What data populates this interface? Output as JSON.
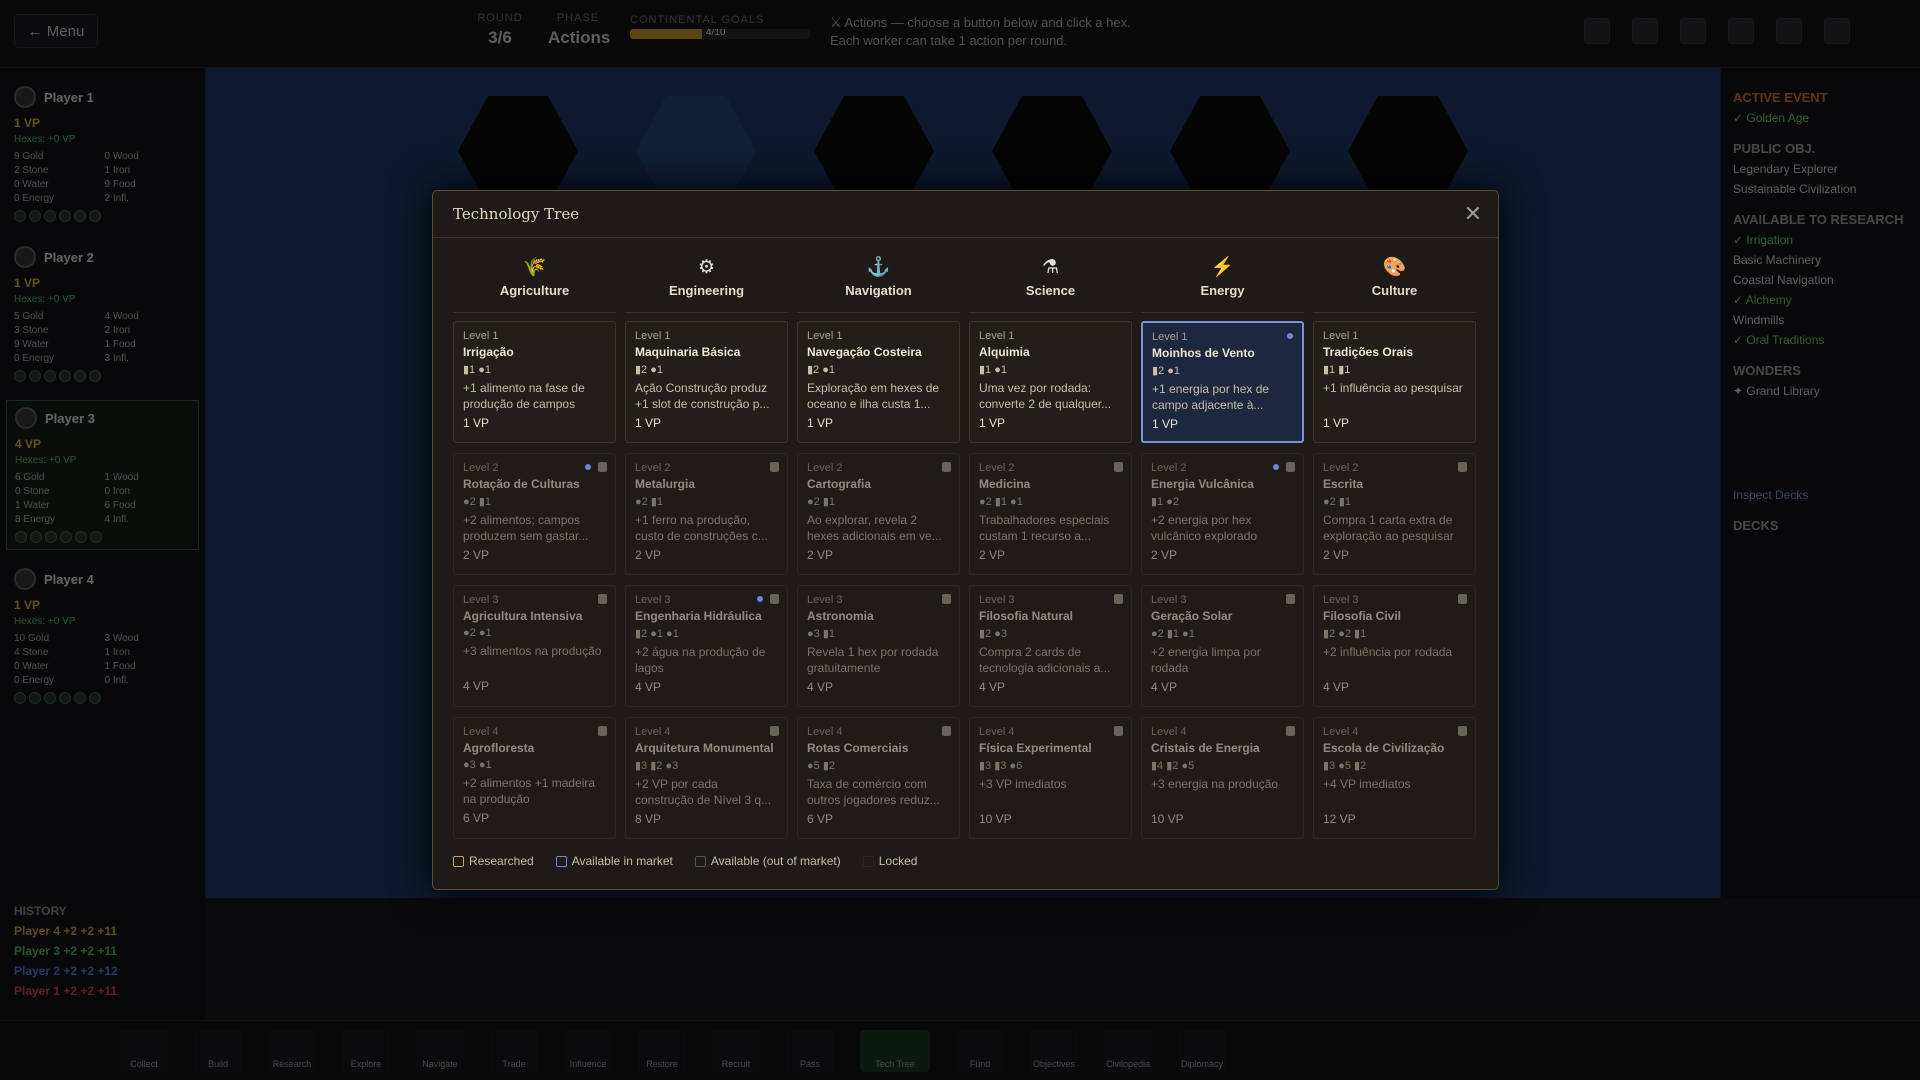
{
  "topbar": {
    "menu_label": "← Menu",
    "round_label": "ROUND",
    "round_value": "3/6",
    "phase_label": "PHASE",
    "phase_value": "Actions",
    "progress_label": "CONTINENTAL GOALS",
    "progress_text": "4/10",
    "progress_fraction": 0.4,
    "hint": "⚔ Actions — choose a button below and click a hex. Each worker can take 1 action per round."
  },
  "players": [
    {
      "name": "Player 1",
      "vp": "1 VP",
      "hexes": "Hexes: +0 VP",
      "res": [
        "9 Gold",
        "0 Wood",
        "2 Stone",
        "1 Iron",
        "0 Water",
        "9 Food",
        "0 Energy",
        "2 Infl."
      ]
    },
    {
      "name": "Player 2",
      "vp": "1 VP",
      "hexes": "Hexes: +0 VP",
      "res": [
        "5 Gold",
        "4 Wood",
        "3 Stone",
        "2 Iron",
        "9 Water",
        "1 Food",
        "0 Energy",
        "3 Infl."
      ]
    },
    {
      "name": "Player 3",
      "vp": "4 VP",
      "hexes": "Hexes: +0 VP",
      "res": [
        "6 Gold",
        "1 Wood",
        "0 Stone",
        "0 Iron",
        "1 Water",
        "6 Food",
        "8 Energy",
        "4 Infl."
      ]
    },
    {
      "name": "Player 4",
      "vp": "1 VP",
      "hexes": "Hexes: +0 VP",
      "res": [
        "10 Gold",
        "3 Wood",
        "4 Stone",
        "1 Iron",
        "0 Water",
        "1 Food",
        "0 Energy",
        "0 Infl."
      ]
    }
  ],
  "history": {
    "title": "HISTORY",
    "rows": [
      "Player 4 +2 +2 +11",
      "Player 3 +2 +2 +11",
      "Player 2 +2 +2 +12",
      "Player 1 +2 +2 +11"
    ]
  },
  "right": {
    "event_title": "ACTIVE EVENT",
    "event_name": "✓ Golden Age",
    "public_title": "PUBLIC OBJ.",
    "public_items": [
      "Legendary Explorer",
      "Sustainable Civilization"
    ],
    "avail_title": "AVAILABLE TO RESEARCH",
    "avail_items": [
      "✓ Irrigation",
      "Basic Machinery",
      "Coastal Navigation",
      "✓ Alchemy",
      "Windmills",
      "✓ Oral Traditions"
    ],
    "wonders_title": "WONDERS",
    "wonders_item": "✦ Grand Library",
    "inspect": "Inspect Decks",
    "decks_title": "DECKS"
  },
  "bottom": [
    "Collect",
    "Build",
    "Research",
    "Explore",
    "Navigate",
    "Trade",
    "Influence",
    "Restore",
    "Recruit",
    "Pass",
    "Tech Tree",
    "Fund",
    "Objectives",
    "Civilopedia",
    "Diplomacy"
  ],
  "modal": {
    "title": "Technology Tree",
    "columns": [
      {
        "name": "Agriculture",
        "icon": "🌾",
        "color": "#6fbf4a",
        "techs": [
          {
            "level": "Level 1",
            "name": "Irrigação",
            "cost": "▮1 ●1",
            "desc": "+1 alimento na fase de produção de campos",
            "vp": "1 VP",
            "state": "researched"
          },
          {
            "level": "Level 2",
            "name": "Rotação de Culturas",
            "cost": "●2 ▮1",
            "desc": "+2 alimentos; campos produzem sem gastar...",
            "vp": "2 VP",
            "state": "locked",
            "market": true
          },
          {
            "level": "Level 3",
            "name": "Agricultura Intensiva",
            "cost": "●2 ●1",
            "desc": "+3 alimentos na produção",
            "vp": "4 VP",
            "state": "locked"
          },
          {
            "level": "Level 4",
            "name": "Agrofloresta",
            "cost": "●3 ●1",
            "desc": "+2 alimentos +1 madeira na produção",
            "vp": "6 VP",
            "state": "locked"
          }
        ]
      },
      {
        "name": "Engineering",
        "icon": "⚙",
        "color": "#e0e0e0",
        "techs": [
          {
            "level": "Level 1",
            "name": "Maquinaria Básica",
            "cost": "▮2 ●1",
            "desc": "Ação Construção produz +1 slot de construção p...",
            "vp": "1 VP",
            "state": "researched"
          },
          {
            "level": "Level 2",
            "name": "Metalurgia",
            "cost": "●2 ▮1",
            "desc": "+1 ferro na produção, custo de construções c...",
            "vp": "2 VP",
            "state": "locked"
          },
          {
            "level": "Level 3",
            "name": "Engenharia Hidráulica",
            "cost": "▮2 ●1 ●1",
            "desc": "+2 água na produção de lagos",
            "vp": "4 VP",
            "state": "locked",
            "market": true
          },
          {
            "level": "Level 4",
            "name": "Arquitetura Monumental",
            "cost": "▮3 ▮2 ●3",
            "desc": "+2 VP por cada construção de Nível 3 q...",
            "vp": "8 VP",
            "state": "locked"
          }
        ]
      },
      {
        "name": "Navigation",
        "icon": "⚓",
        "color": "#3f8fe0",
        "techs": [
          {
            "level": "Level 1",
            "name": "Navegação Costeira",
            "cost": "▮2 ●1",
            "desc": "Exploração em hexes de oceano e ilha custa 1...",
            "vp": "1 VP",
            "state": "researched"
          },
          {
            "level": "Level 2",
            "name": "Cartografia",
            "cost": "●2 ▮1",
            "desc": "Ao explorar, revela 2 hexes adicionais em ve...",
            "vp": "2 VP",
            "state": "locked"
          },
          {
            "level": "Level 3",
            "name": "Astronomia",
            "cost": "●3 ▮1",
            "desc": "Revela 1 hex por rodada gratuitamente",
            "vp": "4 VP",
            "state": "locked"
          },
          {
            "level": "Level 4",
            "name": "Rotas Comerciais",
            "cost": "●5 ▮2",
            "desc": "Taxa de comércio com outros jogadores reduz...",
            "vp": "6 VP",
            "state": "locked"
          }
        ]
      },
      {
        "name": "Science",
        "icon": "⚗",
        "color": "#e0e0e0",
        "techs": [
          {
            "level": "Level 1",
            "name": "Alquimia",
            "cost": "▮1 ●1",
            "desc": "Uma vez por rodada: converte 2 de qualquer...",
            "vp": "1 VP",
            "state": "researched"
          },
          {
            "level": "Level 2",
            "name": "Medicina",
            "cost": "●2 ▮1 ●1",
            "desc": "Trabalhadores especiais custam 1 recurso a...",
            "vp": "2 VP",
            "state": "locked"
          },
          {
            "level": "Level 3",
            "name": "Filosofia Natural",
            "cost": "▮2 ●3",
            "desc": "Compra 2 cards de tecnologia adicionais a...",
            "vp": "4 VP",
            "state": "locked"
          },
          {
            "level": "Level 4",
            "name": "Física Experimental",
            "cost": "▮3 ▮3 ●6",
            "desc": "+3 VP imediatos",
            "vp": "10 VP",
            "state": "locked"
          }
        ]
      },
      {
        "name": "Energy",
        "icon": "⚡",
        "color": "#f08a24",
        "techs": [
          {
            "level": "Level 1",
            "name": "Moinhos de Vento",
            "cost": "▮2 ●1",
            "desc": "+1 energia por hex de campo adjacente à...",
            "vp": "1 VP",
            "state": "selected",
            "market": true
          },
          {
            "level": "Level 2",
            "name": "Energia Vulcânica",
            "cost": "▮1 ●2",
            "desc": "+2 energia por hex vulcânico explorado",
            "vp": "2 VP",
            "state": "locked",
            "market": true
          },
          {
            "level": "Level 3",
            "name": "Geração Solar",
            "cost": "●2 ▮1 ●1",
            "desc": "+2 energia limpa por rodada",
            "vp": "4 VP",
            "state": "locked"
          },
          {
            "level": "Level 4",
            "name": "Cristais de Energia",
            "cost": "▮4 ▮2 ●5",
            "desc": "+3 energia na produção",
            "vp": "10 VP",
            "state": "locked"
          }
        ]
      },
      {
        "name": "Culture",
        "icon": "🎨",
        "color": "#e06a9a",
        "techs": [
          {
            "level": "Level 1",
            "name": "Tradições Orais",
            "cost": "▮1 ▮1",
            "desc": "+1 influência ao pesquisar",
            "vp": "1 VP",
            "state": "researched"
          },
          {
            "level": "Level 2",
            "name": "Escrita",
            "cost": "●2 ▮1",
            "desc": "Compra 1 carta extra de exploração ao pesquisar",
            "vp": "2 VP",
            "state": "locked"
          },
          {
            "level": "Level 3",
            "name": "Filosofia Civil",
            "cost": "▮2 ●2 ▮1",
            "desc": "+2 influência por rodada",
            "vp": "4 VP",
            "state": "locked"
          },
          {
            "level": "Level 4",
            "name": "Escola de Civilização",
            "cost": "▮3 ●5 ▮2",
            "desc": "+4 VP imediatos",
            "vp": "12 VP",
            "state": "locked"
          }
        ]
      }
    ],
    "legend": [
      {
        "label": "Researched",
        "color": "#c8a060"
      },
      {
        "label": "Available in market",
        "color": "#6f86d6"
      },
      {
        "label": "Available (out of market)",
        "color": "#555555"
      },
      {
        "label": "Locked",
        "color": "#2a2622"
      }
    ]
  }
}
